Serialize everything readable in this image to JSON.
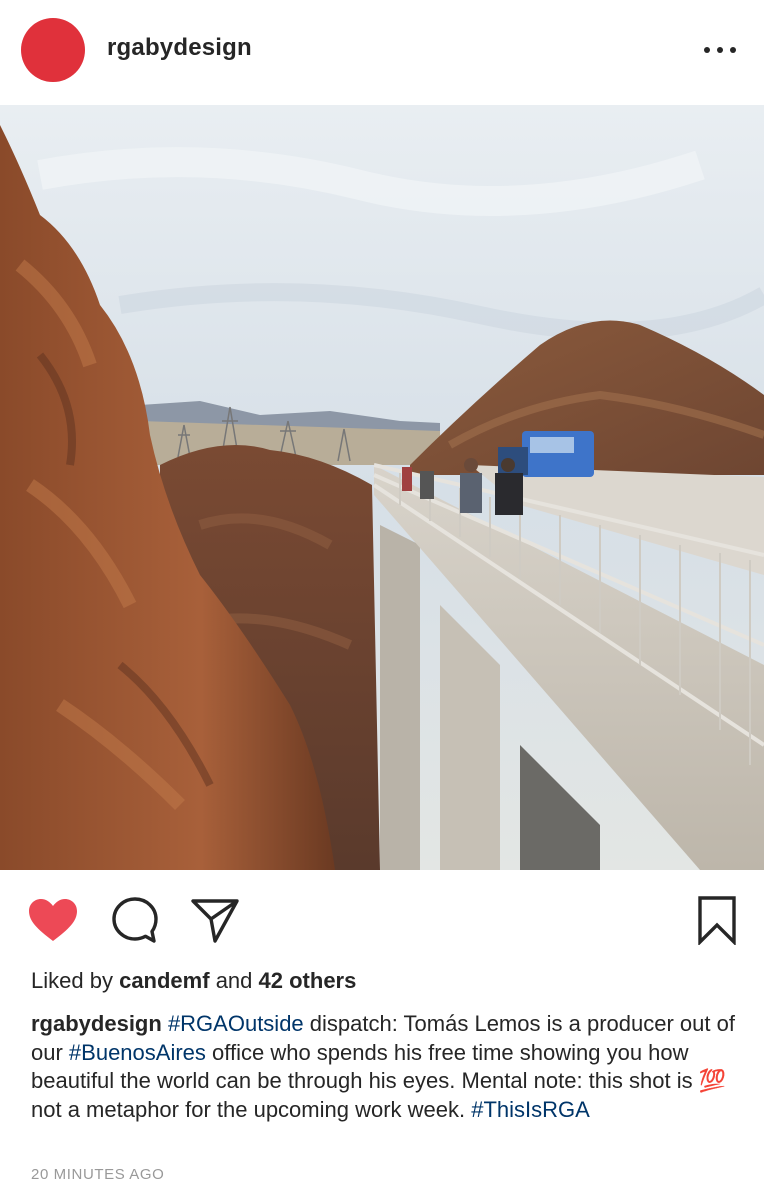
{
  "post": {
    "username": "rgabydesign",
    "avatar_color": "#e0313b",
    "more_icon": "more-horizontal-icon"
  },
  "photo": {
    "alt": "",
    "colors": {
      "sky": "#dfe6ec",
      "rock": "#a35a34",
      "bridge": "#c9c3b8",
      "truck": "#3e74c9"
    }
  },
  "actions": {
    "like_icon": "heart-filled-icon",
    "like_color": "#ed4956",
    "comment_icon": "comment-icon",
    "share_icon": "direct-share-icon",
    "save_icon": "bookmark-icon"
  },
  "likes": {
    "prefix": "Liked by",
    "user": "candemf",
    "middle": "and",
    "others": "42 others"
  },
  "caption": {
    "username": "rgabydesign",
    "tag1": "#RGAOutside",
    "text1": " dispatch: Tomás Lemos is a producer out of our ",
    "tag2": "#BuenosAires",
    "text2": " office who spends his free time showing you how beautiful the world can be through his eyes. Mental note: this shot is ",
    "emoji": "💯",
    "text3": " not a metaphor for the upcoming work week. ",
    "tag3": "#ThisIsRGA"
  },
  "timestamp": "20 MINUTES AGO"
}
